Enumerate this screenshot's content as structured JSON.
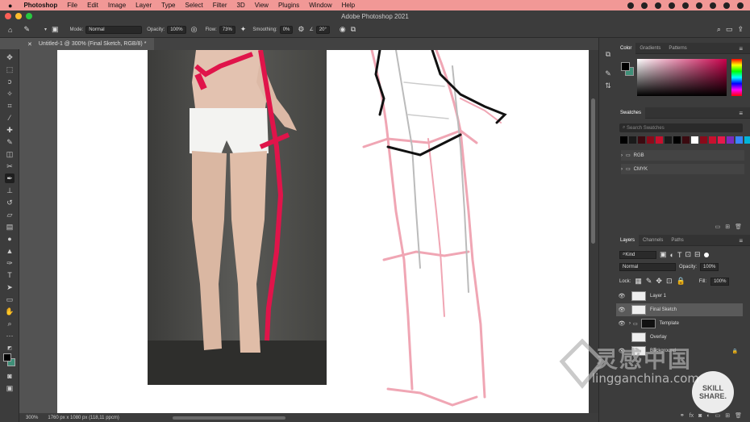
{
  "menubar": {
    "apple": "",
    "items": [
      "Photoshop",
      "File",
      "Edit",
      "Image",
      "Layer",
      "Type",
      "Select",
      "Filter",
      "3D",
      "View",
      "Plugins",
      "Window",
      "Help"
    ]
  },
  "titlebar": {
    "title": "Adobe Photoshop 2021"
  },
  "options": {
    "mode_label": "Mode:",
    "mode_value": "Normal",
    "opacity_label": "Opacity:",
    "opacity_value": "100%",
    "flow_label": "Flow:",
    "flow_value": "73%",
    "smoothing_label": "Smoothing:",
    "smoothing_value": "0%",
    "angle_value": "20°"
  },
  "document": {
    "tab_label": "Untitled-1 @ 300% (Final Sketch, RGB/8) *"
  },
  "status": {
    "zoom": "300%",
    "doc_info": "1760 px x 1080 px (118,11 ppcm)"
  },
  "color_panel": {
    "tabs": [
      "Color",
      "Gradients",
      "Patterns"
    ],
    "fg_color": "#000000",
    "bg_color": "#3f8f78"
  },
  "swatches_panel": {
    "title": "Swatches",
    "search_placeholder": "Search Swatches",
    "swatches": [
      "#000000",
      "#1a1a1a",
      "#3a0a10",
      "#8a0a1a",
      "#c8102e",
      "#1a1a1a",
      "#000000",
      "#3a0a10",
      "#ffffff",
      "#8a0a1a",
      "#c8102e",
      "#e6194b",
      "#7b2cbf",
      "#3a86ff",
      "#00b4d8",
      "#ff006e"
    ],
    "groups": [
      "RGB",
      "CMYK"
    ]
  },
  "layers_panel": {
    "tabs": [
      "Layers",
      "Channels",
      "Paths"
    ],
    "kind_label": "Kind",
    "blend_mode": "Normal",
    "opacity_label": "Opacity:",
    "opacity_value": "100%",
    "lock_label": "Lock:",
    "fill_label": "Fill:",
    "fill_value": "100%",
    "layers": [
      {
        "name": "Layer 1",
        "visible": true,
        "selected": false
      },
      {
        "name": "Final Sketch",
        "visible": true,
        "selected": true
      },
      {
        "name": "Template",
        "visible": true,
        "selected": false
      },
      {
        "name": "Overlay",
        "visible": false,
        "selected": false
      },
      {
        "name": "Background",
        "visible": true,
        "selected": false
      }
    ]
  },
  "watermark": {
    "brand": "灵感中国",
    "url": "lingganchina.com",
    "badge_top": "SKILL",
    "badge_bottom": "SHARE."
  }
}
